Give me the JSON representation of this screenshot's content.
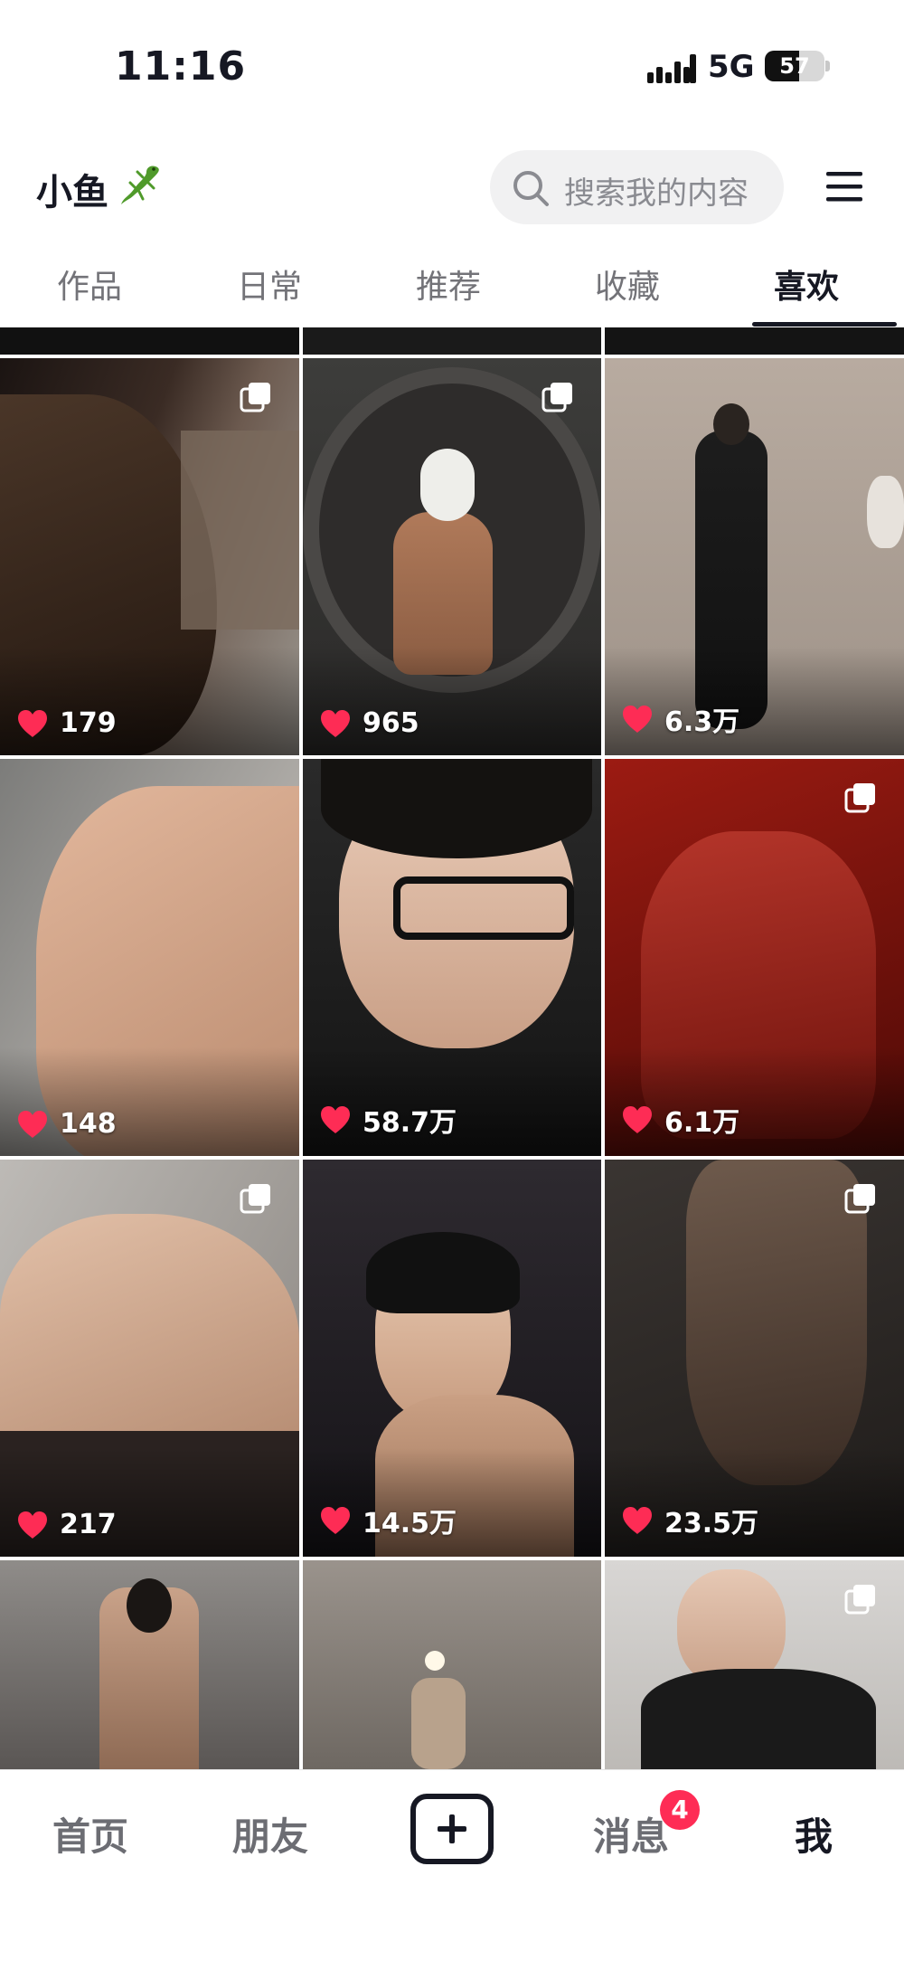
{
  "status_bar": {
    "time": "11:16",
    "network": "5G",
    "battery": "57",
    "battery_level_percent": 57
  },
  "header": {
    "profile_name": "小鱼",
    "search_placeholder": "搜索我的内容"
  },
  "tabs": [
    {
      "label": "作品",
      "active": false
    },
    {
      "label": "日常",
      "active": false
    },
    {
      "label": "推荐",
      "active": false
    },
    {
      "label": "收藏",
      "active": false
    },
    {
      "label": "喜欢",
      "active": true
    }
  ],
  "grid": {
    "rows": [
      [
        {
          "likes": "179",
          "multi": true
        },
        {
          "likes": "965",
          "multi": true
        },
        {
          "likes": "6.3万",
          "multi": false
        }
      ],
      [
        {
          "likes": "148",
          "multi": false
        },
        {
          "likes": "58.7万",
          "multi": false
        },
        {
          "likes": "6.1万",
          "multi": true
        }
      ],
      [
        {
          "likes": "217",
          "multi": true
        },
        {
          "likes": "14.5万",
          "multi": false
        },
        {
          "likes": "23.5万",
          "multi": true
        }
      ],
      [
        {
          "likes": "",
          "multi": false
        },
        {
          "likes": "",
          "multi": false
        },
        {
          "likes": "",
          "multi": true
        }
      ]
    ]
  },
  "bottom_nav": {
    "home": "首页",
    "friends": "朋友",
    "messages": "消息",
    "messages_badge": "4",
    "me": "我"
  },
  "colors": {
    "accent": "#fe2c55",
    "text": "#161823",
    "muted": "#737378"
  },
  "icons": [
    "signal-icon",
    "lizard-icon",
    "search-icon",
    "menu-icon",
    "heart-icon",
    "multi-image-icon",
    "plus-icon"
  ]
}
